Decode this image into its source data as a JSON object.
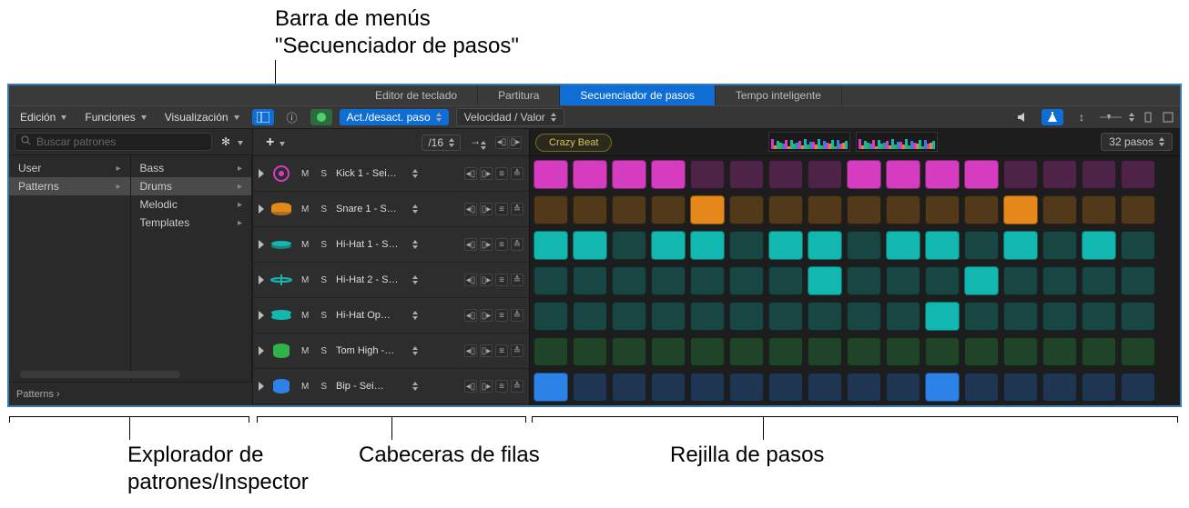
{
  "callouts": {
    "menubar": "Barra de menús\n\"Secuenciador de pasos\"",
    "browser": "Explorador de\npatrones/Inspector",
    "rowheaders": "Cabeceras de filas",
    "stepgrid": "Rejilla de pasos"
  },
  "tabs": {
    "piano": "Editor de teclado",
    "score": "Partitura",
    "stepseq": "Secuenciador de pasos",
    "smarttempo": "Tempo inteligente"
  },
  "menubar": {
    "edit": "Edición",
    "functions": "Funciones",
    "view": "Visualización",
    "mode_toggle": "Act./desact. paso",
    "velocity": "Velocidad / Valor"
  },
  "toolbar": {
    "division": "/16",
    "steps": "32 pasos"
  },
  "browser": {
    "search_placeholder": "Buscar patrones",
    "col1": [
      {
        "label": "User",
        "arrow": true
      },
      {
        "label": "Patterns",
        "arrow": true,
        "selected": true
      }
    ],
    "col2": [
      {
        "label": "Bass",
        "arrow": true
      },
      {
        "label": "Drums",
        "arrow": true,
        "selected": true
      },
      {
        "label": "Melodic",
        "arrow": true
      },
      {
        "label": "Templates",
        "arrow": true
      }
    ],
    "breadcrumb": "Patterns  ›"
  },
  "pattern": {
    "name": "Crazy Beat"
  },
  "rows": [
    {
      "name": "Kick 1 - Sei…",
      "color": "#d63cc0",
      "icon": "kick",
      "steps": [
        1,
        1,
        1,
        1,
        0,
        0,
        0,
        0,
        1,
        1,
        1,
        1,
        0,
        0,
        0,
        0
      ]
    },
    {
      "name": "Snare 1 - S…",
      "color": "#e58a1a",
      "icon": "snare",
      "steps": [
        0,
        0,
        0,
        0,
        1,
        0,
        0,
        0,
        0,
        0,
        0,
        0,
        1,
        0,
        0,
        0
      ]
    },
    {
      "name": "Hi-Hat 1 - S…",
      "color": "#12b8b0",
      "icon": "hihat",
      "steps": [
        1,
        1,
        0,
        1,
        1,
        0,
        1,
        1,
        0,
        1,
        1,
        0,
        1,
        0,
        1,
        0
      ]
    },
    {
      "name": "Hi-Hat 2 - S…",
      "color": "#12b8b0",
      "icon": "hihat2",
      "steps": [
        0,
        0,
        0,
        0,
        0,
        0,
        0,
        1,
        0,
        0,
        0,
        1,
        0,
        0,
        0,
        0
      ]
    },
    {
      "name": "Hi-Hat Op…",
      "color": "#12b8b0",
      "icon": "openhh",
      "steps": [
        0,
        0,
        0,
        0,
        0,
        0,
        0,
        0,
        0,
        0,
        1,
        0,
        0,
        0,
        0,
        0
      ]
    },
    {
      "name": "Tom High -…",
      "color": "#2fb24a",
      "icon": "tom",
      "steps": [
        0,
        0,
        0,
        0,
        0,
        0,
        0,
        0,
        0,
        0,
        0,
        0,
        0,
        0,
        0,
        0
      ]
    },
    {
      "name": "Bip - Sei…",
      "color": "#2c82e6",
      "icon": "drum",
      "steps": [
        1,
        0,
        0,
        0,
        0,
        0,
        0,
        0,
        0,
        0,
        1,
        0,
        0,
        0,
        0,
        0
      ]
    }
  ]
}
